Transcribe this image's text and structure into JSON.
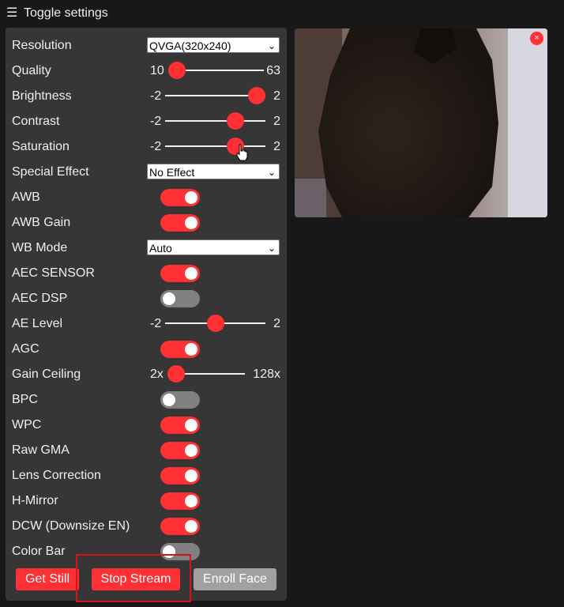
{
  "header": {
    "menu_icon": "☰",
    "title": "Toggle settings"
  },
  "settings": {
    "resolution": {
      "label": "Resolution",
      "value": "QVGA(320x240)"
    },
    "quality": {
      "label": "Quality",
      "min": "10",
      "max": "63",
      "value_fraction": 0.0
    },
    "brightness": {
      "label": "Brightness",
      "min": "-2",
      "max": "2",
      "value_fraction": 1.0
    },
    "contrast": {
      "label": "Contrast",
      "min": "-2",
      "max": "2",
      "value_fraction": 0.7
    },
    "saturation": {
      "label": "Saturation",
      "min": "-2",
      "max": "2",
      "value_fraction": 0.7
    },
    "special_effect": {
      "label": "Special Effect",
      "value": "No Effect"
    },
    "awb": {
      "label": "AWB",
      "on": true
    },
    "awb_gain": {
      "label": "AWB Gain",
      "on": true
    },
    "wb_mode": {
      "label": "WB Mode",
      "value": "Auto"
    },
    "aec_sensor": {
      "label": "AEC SENSOR",
      "on": true
    },
    "aec_dsp": {
      "label": "AEC DSP",
      "on": false
    },
    "ae_level": {
      "label": "AE Level",
      "min": "-2",
      "max": "2",
      "value_fraction": 0.5
    },
    "agc": {
      "label": "AGC",
      "on": true
    },
    "gain_ceiling": {
      "label": "Gain Ceiling",
      "min": "2x",
      "max": "128x",
      "value_fraction": 0.0
    },
    "bpc": {
      "label": "BPC",
      "on": false
    },
    "wpc": {
      "label": "WPC",
      "on": true
    },
    "raw_gma": {
      "label": "Raw GMA",
      "on": true
    },
    "lens_correction": {
      "label": "Lens Correction",
      "on": true
    },
    "h_mirror": {
      "label": "H-Mirror",
      "on": true
    },
    "dcw": {
      "label": "DCW (Downsize EN)",
      "on": true
    },
    "color_bar": {
      "label": "Color Bar",
      "on": false
    }
  },
  "buttons": {
    "get_still": "Get Still",
    "stop_stream": "Stop Stream",
    "enroll_face": "Enroll Face"
  },
  "preview": {
    "close_icon": "×"
  },
  "colors": {
    "accent": "#ff3034",
    "panel": "#363636",
    "background": "#181818",
    "toggle_off": "#808080",
    "disabled_button": "#a0a0a0"
  }
}
